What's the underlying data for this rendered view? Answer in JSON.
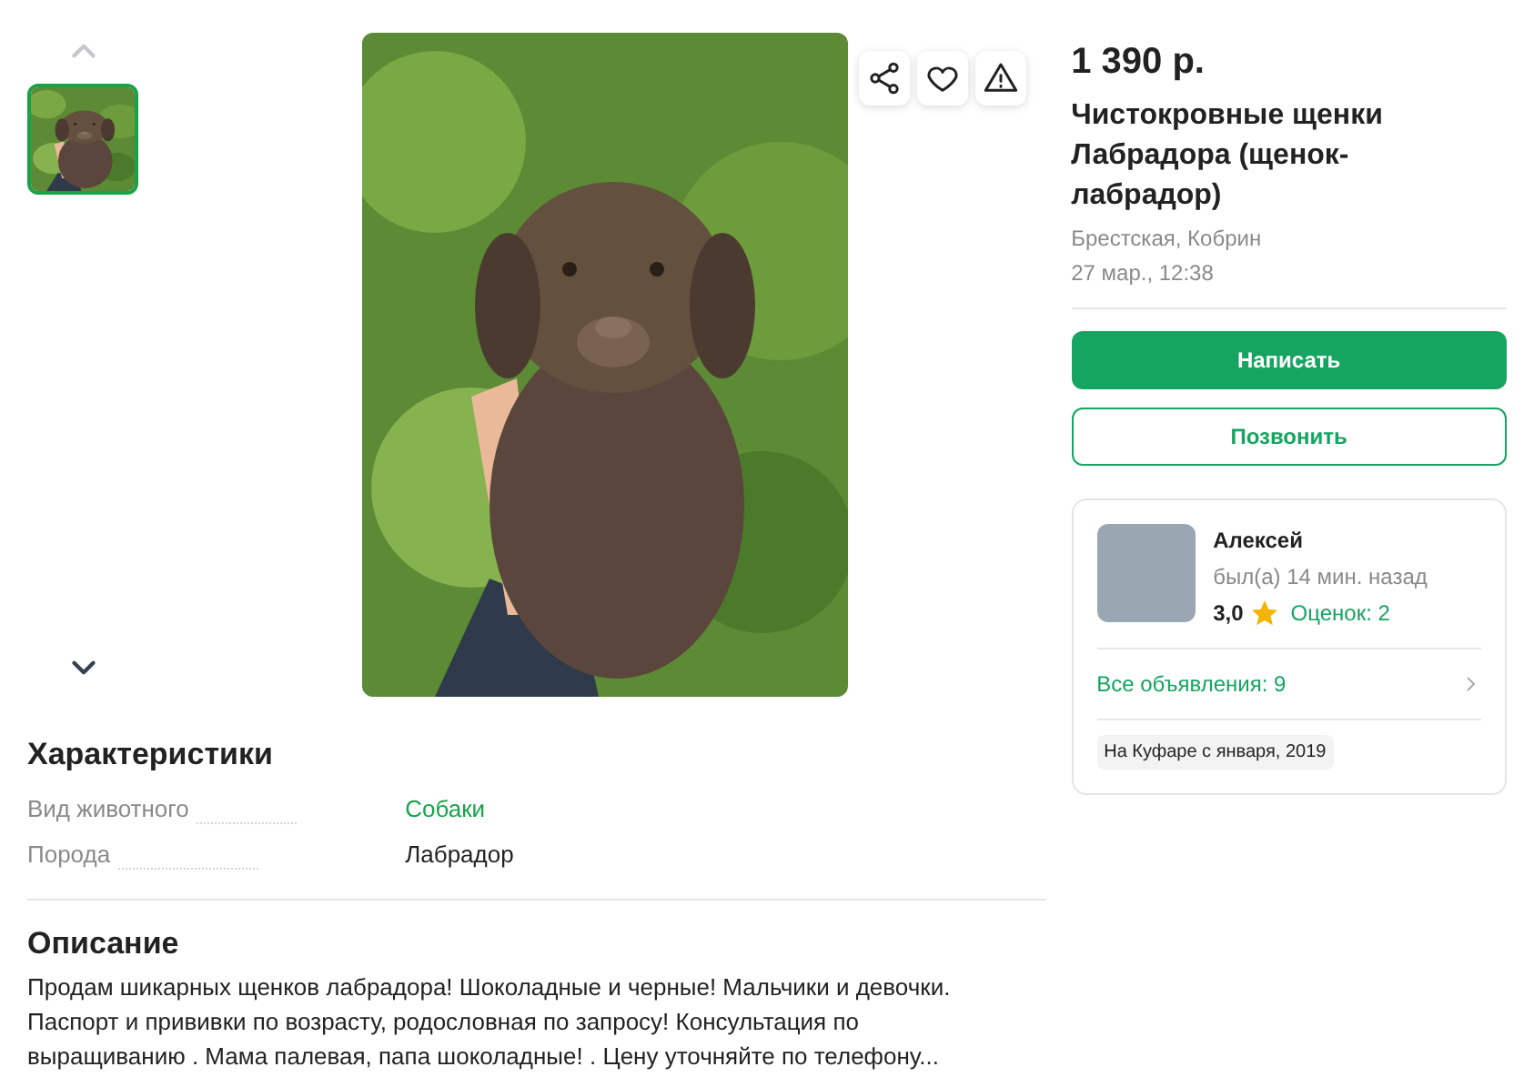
{
  "gallery": {
    "arrows": [
      {
        "kind": "up",
        "disabled": true
      },
      {
        "kind": "down",
        "disabled": false
      }
    ],
    "thumbnails": [
      {
        "selected": true
      }
    ],
    "actions": [
      {
        "kind": "share"
      },
      {
        "kind": "favorite"
      },
      {
        "kind": "report"
      }
    ]
  },
  "listing": {
    "price": "1 390 р.",
    "title": "Чистокровные щенки Лабрадора (щенок-лабрадор)",
    "location": "Брестская, Кобрин",
    "date": "27 мар., 12:38"
  },
  "buttons": [
    {
      "kind": "primary",
      "label": "Написать"
    },
    {
      "kind": "outline",
      "label": "Позвонить"
    }
  ],
  "seller": {
    "name": "Алексей",
    "last_seen": "был(а) 14 мин. назад",
    "rating": "3,0",
    "reviews": "Оценок: 2",
    "all_ads": "Все объявления: 9",
    "since": "На Куфаре с января, 2019"
  },
  "characteristics": {
    "title": "Характеристики",
    "rows": [
      {
        "label": "Вид животного",
        "value": "Собаки",
        "link": true
      },
      {
        "label": "Порода",
        "value": "Лабрадор",
        "link": false
      }
    ]
  },
  "description": {
    "title": "Описание",
    "text": "Продам шикарных щенков лабрадора! Шоколадные и черные! Мальчики и девочки. Паспорт и прививки по возрасту, родословная по запросу! Консультация по выращиванию . Мама палевая, папа шоколадные! . Цену уточняйте по телефону..."
  }
}
